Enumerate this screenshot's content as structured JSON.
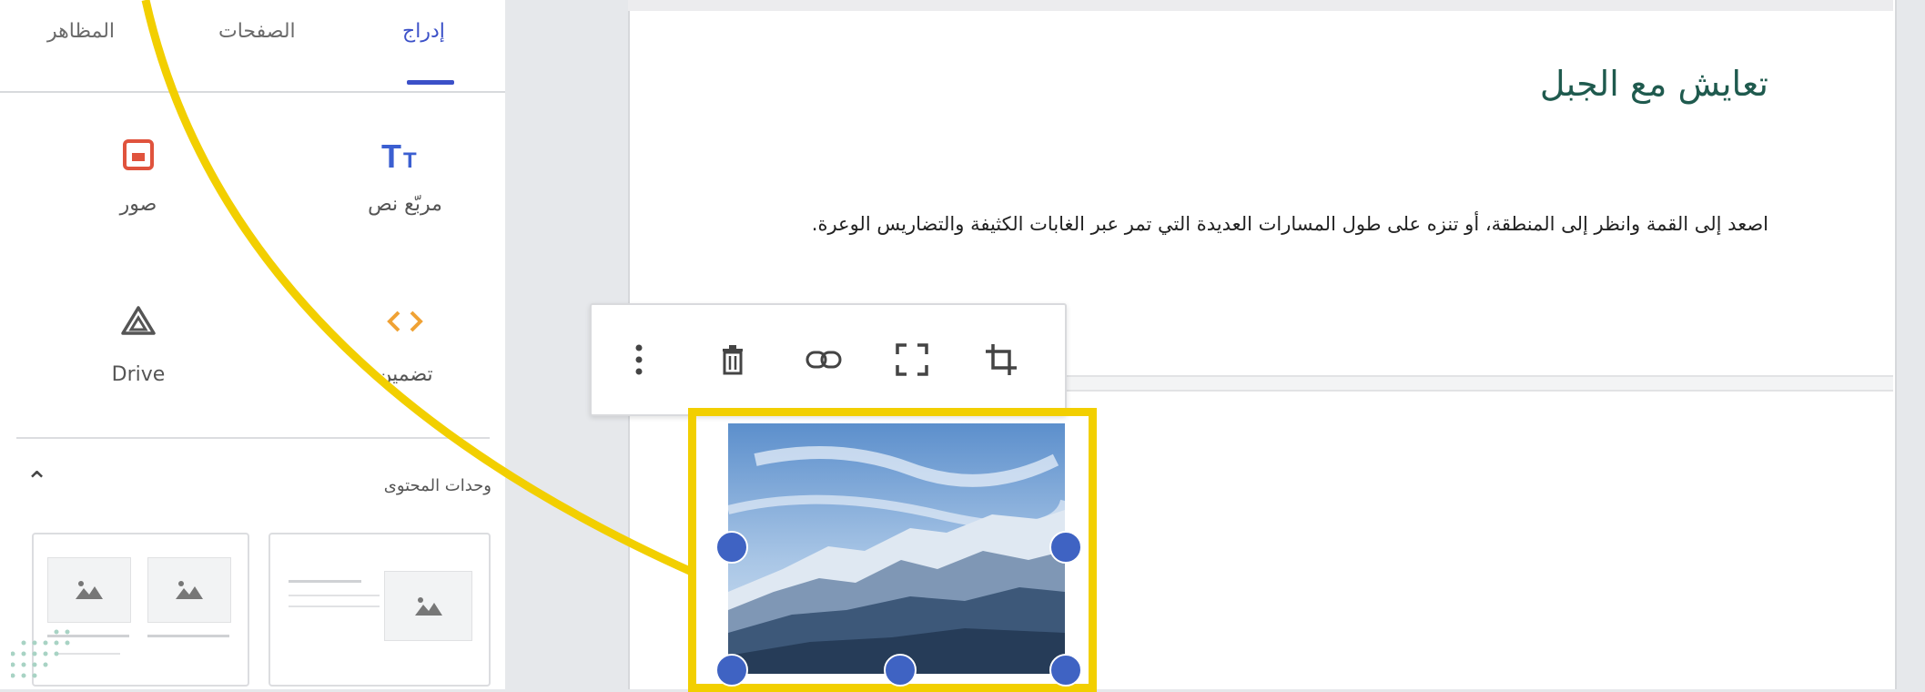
{
  "sidebar": {
    "tabs": [
      {
        "label": "إدراج",
        "active": true
      },
      {
        "label": "الصفحات",
        "active": false
      },
      {
        "label": "المظاهر",
        "active": false
      }
    ],
    "insert_items": [
      {
        "label": "مربّع نص",
        "icon": "text-box-icon"
      },
      {
        "label": "صور",
        "icon": "image-icon"
      },
      {
        "label": "تضمين",
        "icon": "embed-icon"
      },
      {
        "label": "Drive",
        "icon": "drive-icon"
      }
    ],
    "content_blocks_label": "وحدات المحتوى"
  },
  "page": {
    "title": "تعايش مع الجبل",
    "paragraph": "اصعد إلى القمة وانظر إلى المنطقة، أو تنزه على طول المسارات العديدة التي تمر عبر الغابات الكثيفة والتضاريس الوعرة."
  },
  "image_toolbar": {
    "buttons": [
      "more-options-icon",
      "delete-icon",
      "link-icon",
      "fullscreen-icon",
      "crop-icon"
    ]
  },
  "colors": {
    "accent": "#3b50c8",
    "highlight": "#f2cf00",
    "handle": "#3f63c3",
    "title": "#1f5a4e"
  }
}
